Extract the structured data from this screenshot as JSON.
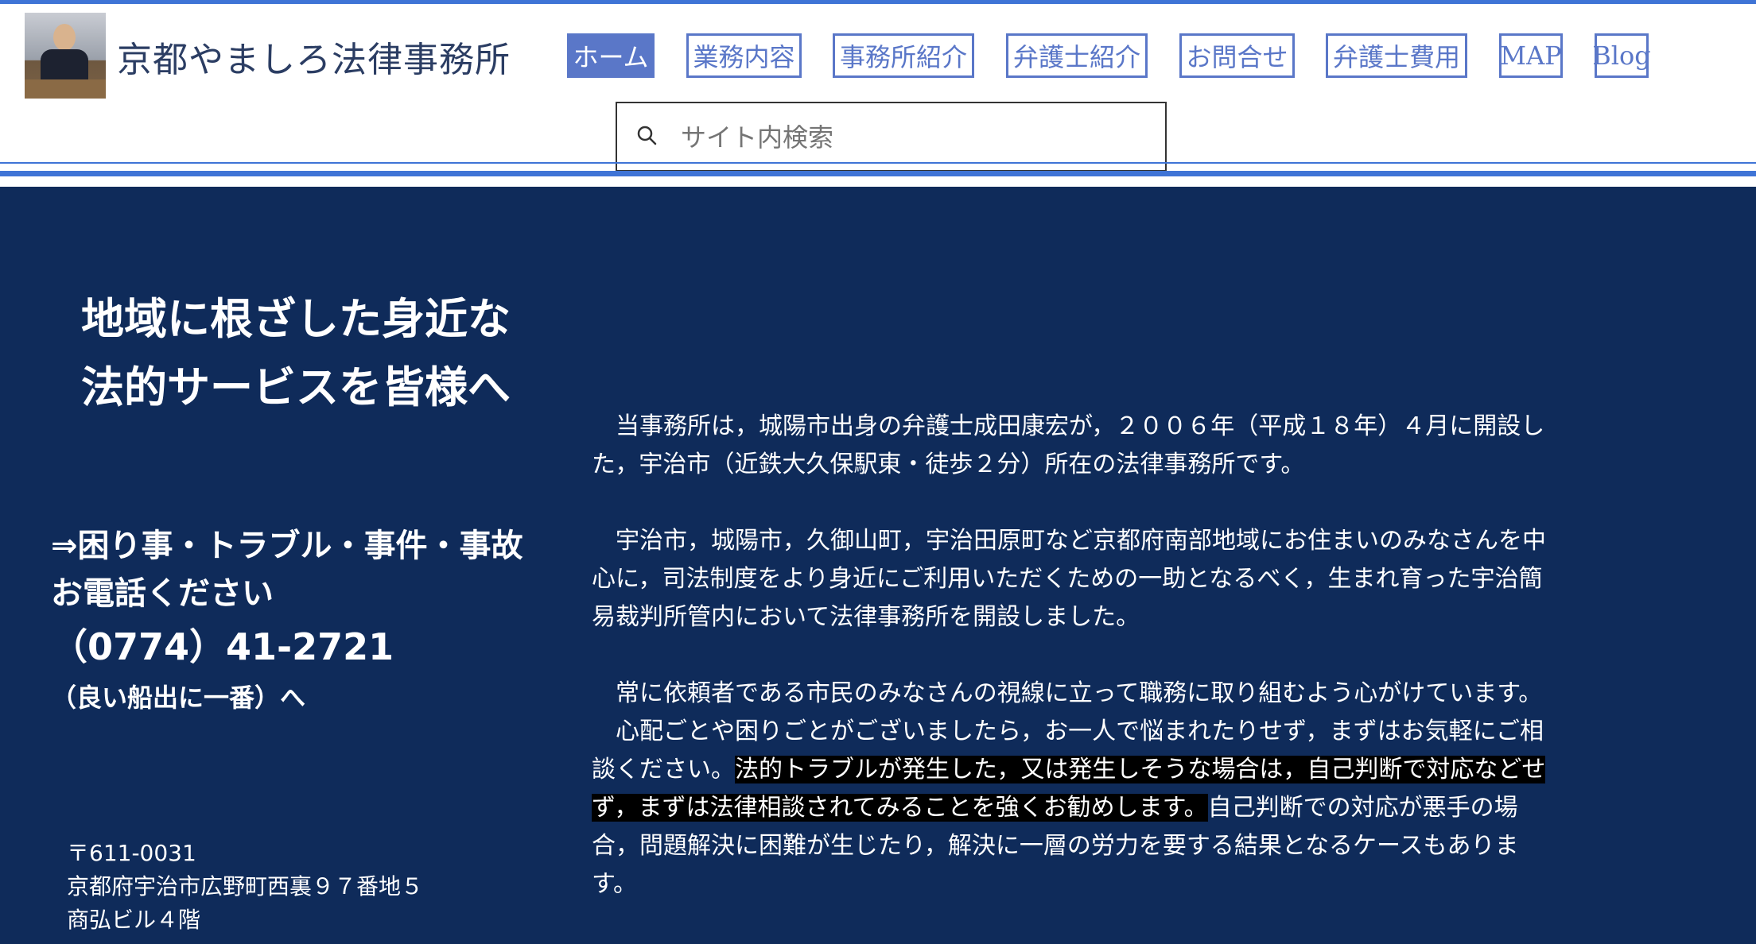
{
  "header": {
    "site_title": "京都やましろ法律事務所",
    "nav": [
      {
        "label": "ホーム",
        "active": true
      },
      {
        "label": "業務内容",
        "active": false
      },
      {
        "label": "事務所紹介",
        "active": false
      },
      {
        "label": "弁護士紹介",
        "active": false
      },
      {
        "label": "お問合せ",
        "active": false
      },
      {
        "label": "弁護士費用",
        "active": false
      },
      {
        "label": "MAP",
        "active": false
      },
      {
        "label": "Blog",
        "active": false
      }
    ],
    "search": {
      "placeholder": "サイト内検索"
    }
  },
  "hero": {
    "line1": "地域に根ざした身近な",
    "line2": "法的サービスを皆様へ"
  },
  "contact": {
    "line1": "⇒困り事・トラブル・事件・事故",
    "line2": "お電話ください",
    "phone": "（0774）41-2721",
    "note": "（良い船出に一番）へ"
  },
  "address": {
    "postal": "〒611-0031",
    "line1": "京都府宇治市広野町西裏９７番地５",
    "line2": "商弘ビル４階"
  },
  "body": {
    "p1": "　当事務所は，城陽市出身の弁護士成田康宏が，２００６年（平成１８年）４月に開設した，宇治市（近鉄大久保駅東・徒歩２分）所在の法律事務所です。",
    "p2": "　宇治市，城陽市，久御山町，宇治田原町など京都府南部地域にお住まいのみなさんを中心に，司法制度をより身近にご利用いただくための一助となるべく，生まれ育った宇治簡易裁判所管内において法律事務所を開設しました。",
    "p3": "　常に依頼者である市民のみなさんの視線に立って職務に取り組むよう心がけています。",
    "p4_pre": "　心配ごとや困りごとがございましたら，お一人で悩まれたりせず，まずはお気軽にご相談ください。",
    "p4_highlight": "法的トラブルが発生した，又は発生しそうな場合は，自己判断で対応などせず，まずは法律相談されてみることを強くお勧めします。",
    "p4_post": "自己判断での対応が悪手の場合，問題解決に困難が生じたり，解決に一層の労力を要する結果となるケースもあります。"
  },
  "colors": {
    "accent": "#5a77c8",
    "rule": "#3f74d6",
    "main_bg": "#0f2b5a"
  }
}
